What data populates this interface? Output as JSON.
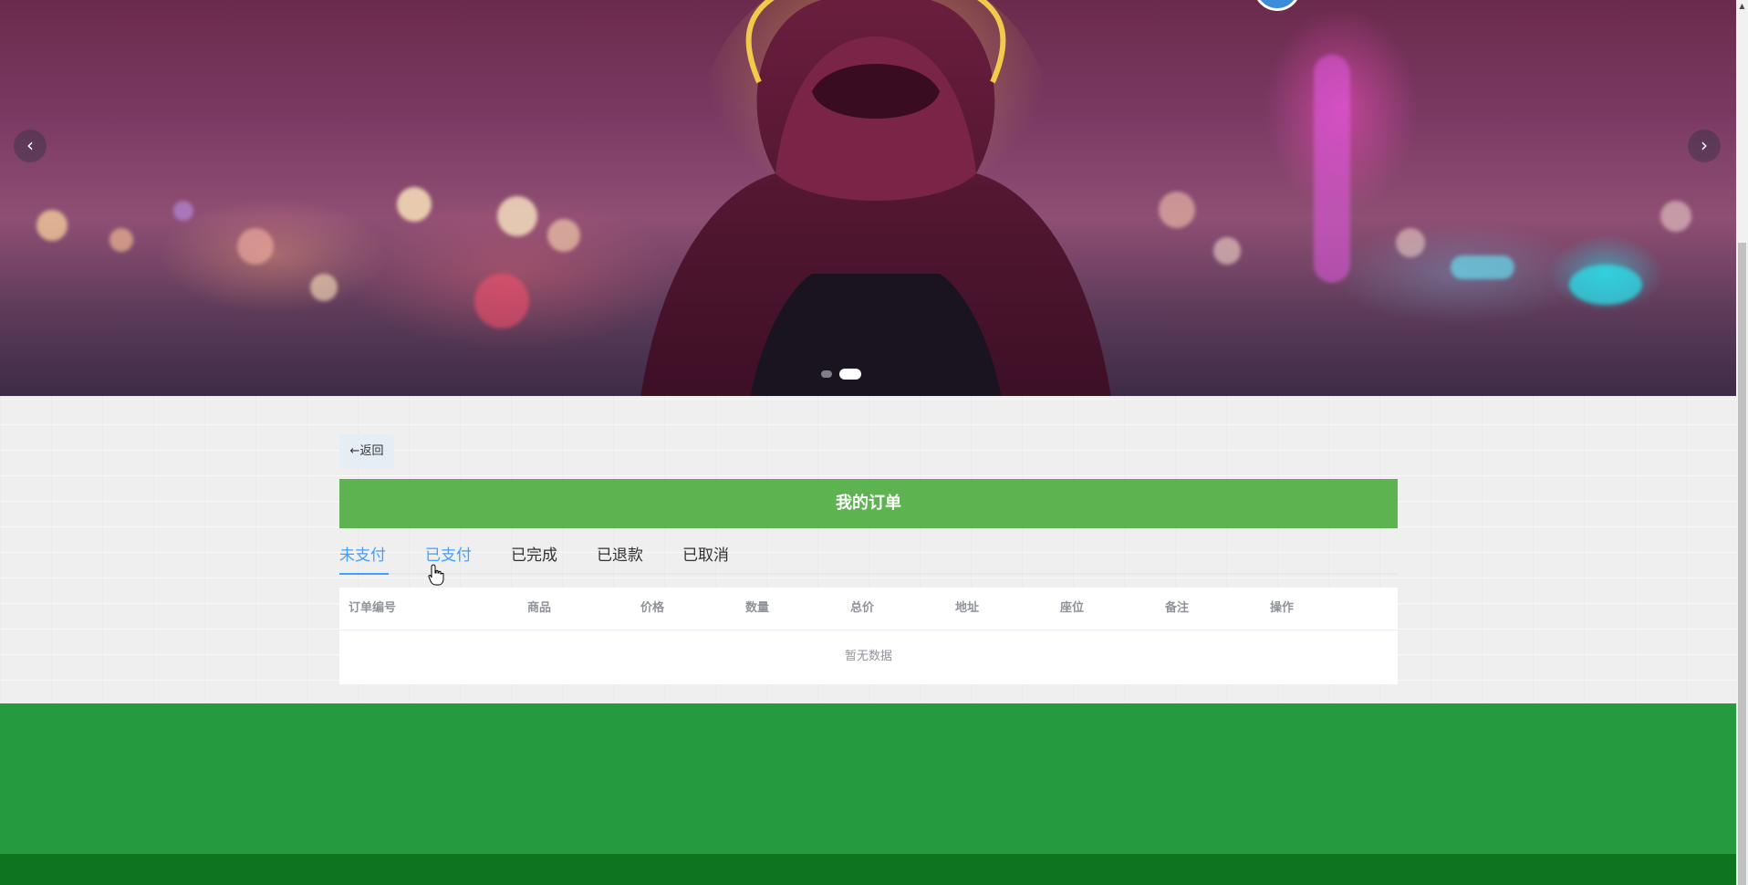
{
  "hero": {
    "prev_arrow": "‹",
    "next_arrow": "›",
    "slides": 2,
    "active_slide": 2
  },
  "back_button": {
    "label": "←返回"
  },
  "title_bar": {
    "text": "我的订单"
  },
  "tabs": [
    {
      "label": "未支付",
      "active": true
    },
    {
      "label": "已支付",
      "active": false
    },
    {
      "label": "已完成",
      "active": false
    },
    {
      "label": "已退款",
      "active": false
    },
    {
      "label": "已取消",
      "active": false
    }
  ],
  "table": {
    "columns": [
      "订单编号",
      "商品",
      "价格",
      "数量",
      "总价",
      "地址",
      "座位",
      "备注",
      "操作"
    ],
    "rows": [],
    "empty_text": "暂无数据"
  },
  "colors": {
    "title_bar": "#5cb34f",
    "active_tab": "#409eff",
    "footer": "#259a3e",
    "footer_bottom": "#0e741f"
  },
  "icons": {
    "prev": "chevron-left-icon",
    "next": "chevron-right-icon",
    "cursor": "hand-pointer-cursor"
  }
}
